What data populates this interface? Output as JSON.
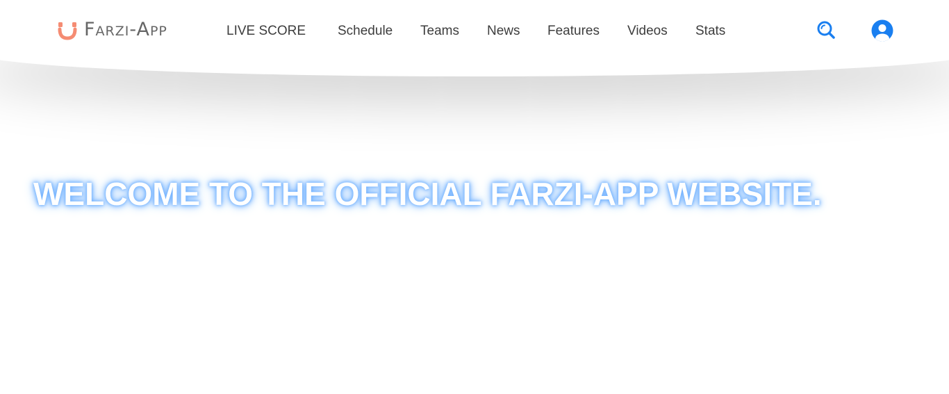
{
  "brand": {
    "name": "Farzi-App",
    "accent_color": "#f58c73"
  },
  "nav": {
    "items": [
      {
        "label": "LIVE SCORE"
      },
      {
        "label": "Schedule"
      },
      {
        "label": "Teams"
      },
      {
        "label": "News"
      },
      {
        "label": "Features"
      },
      {
        "label": "Videos"
      },
      {
        "label": "Stats"
      }
    ],
    "icon_color": "#1a7ff0",
    "search_icon": "search-icon",
    "user_icon": "user-account-icon"
  },
  "hero": {
    "title": "WELCOME TO THE OFFICIAL FARZI-APP WEBSITE.",
    "glow_color": "#6fb0ff"
  }
}
